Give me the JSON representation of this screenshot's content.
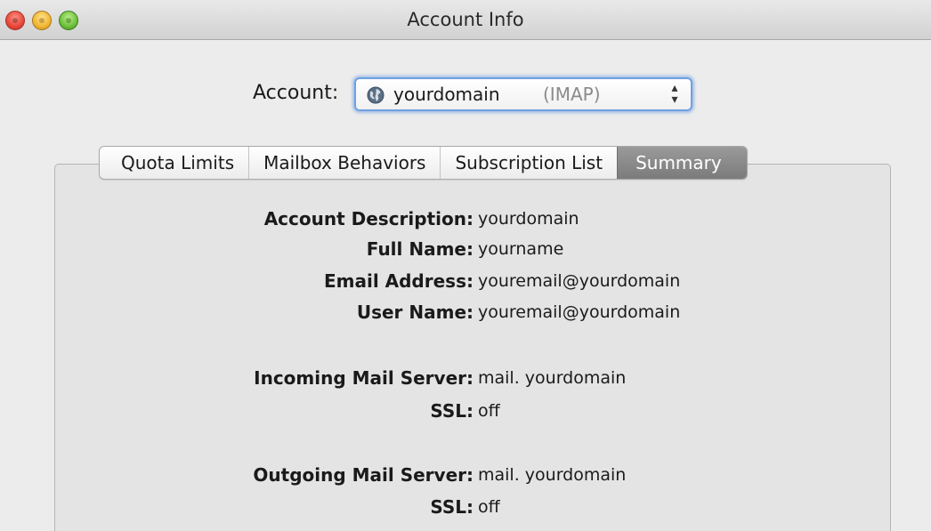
{
  "window": {
    "title": "Account Info"
  },
  "account": {
    "label": "Account:",
    "selected_value": "yourdomain",
    "selected_suffix": "(IMAP)",
    "icon": "globe-icon"
  },
  "tabs": [
    {
      "label": "Quota Limits",
      "selected": false
    },
    {
      "label": "Mailbox Behaviors",
      "selected": false
    },
    {
      "label": "Subscription List",
      "selected": false
    },
    {
      "label": "Summary",
      "selected": true
    }
  ],
  "summary": {
    "account_description": {
      "label": "Account Description:",
      "value": "yourdomain"
    },
    "full_name": {
      "label": "Full Name:",
      "value": "yourname"
    },
    "email_address": {
      "label": "Email Address:",
      "value": "youremail@yourdomain"
    },
    "user_name": {
      "label": "User Name:",
      "value": "youremail@yourdomain"
    },
    "incoming_server": {
      "label": "Incoming Mail Server:",
      "value": "mail. yourdomain"
    },
    "incoming_ssl": {
      "label": "SSL:",
      "value": "off"
    },
    "outgoing_server": {
      "label": "Outgoing Mail Server:",
      "value": "mail. yourdomain"
    },
    "outgoing_ssl": {
      "label": "SSL:",
      "value": "off"
    }
  },
  "colors": {
    "selected_tab": "#8a8a8a",
    "focus_ring": "#6fa1df",
    "close_button": "#e9463a",
    "minimize_button": "#f1b632",
    "zoom_button": "#6fc03c"
  }
}
